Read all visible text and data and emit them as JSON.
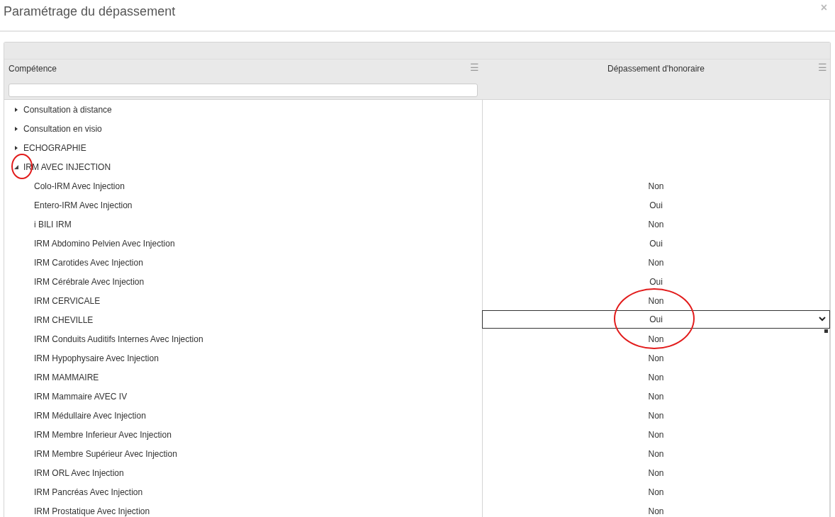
{
  "dialog": {
    "title": "Paramétrage du dépassement",
    "close": "×"
  },
  "grid": {
    "columns": [
      {
        "label": "Compétence",
        "menu": "☰"
      },
      {
        "label": "Dépassement d'honoraire",
        "menu": "☰"
      }
    ],
    "rows": [
      {
        "label": "Consultation à distance",
        "expanded": false,
        "circled": false,
        "children": []
      },
      {
        "label": "Consultation en visio",
        "expanded": false,
        "circled": false,
        "children": []
      },
      {
        "label": "ECHOGRAPHIE",
        "expanded": false,
        "circled": false,
        "children": []
      },
      {
        "label": "IRM AVEC INJECTION",
        "expanded": true,
        "circled": true,
        "children": [
          {
            "label": "Colo-IRM Avec Injection",
            "value": "Non",
            "editing": false,
            "circled": false
          },
          {
            "label": "Entero-IRM Avec Injection",
            "value": "Oui",
            "editing": false,
            "circled": false
          },
          {
            "label": "i BILI IRM",
            "value": "Non",
            "editing": false,
            "circled": false
          },
          {
            "label": "IRM Abdomino Pelvien Avec Injection",
            "value": "Oui",
            "editing": false,
            "circled": false
          },
          {
            "label": "IRM Carotides Avec Injection",
            "value": "Non",
            "editing": false,
            "circled": false
          },
          {
            "label": "IRM Cérébrale Avec Injection",
            "value": "Oui",
            "editing": false,
            "circled": false
          },
          {
            "label": "IRM CERVICALE",
            "value": "Non",
            "editing": false,
            "circled": false
          },
          {
            "label": "IRM CHEVILLE",
            "value": "Oui",
            "editing": true,
            "circled": true
          },
          {
            "label": "IRM Conduits Auditifs Internes Avec Injection",
            "value": "Non",
            "editing": false,
            "circled": false
          },
          {
            "label": "IRM Hypophysaire Avec Injection",
            "value": "Non",
            "editing": false,
            "circled": false
          },
          {
            "label": "IRM MAMMAIRE",
            "value": "Non",
            "editing": false,
            "circled": false
          },
          {
            "label": "IRM Mammaire AVEC IV",
            "value": "Non",
            "editing": false,
            "circled": false
          },
          {
            "label": "IRM Médullaire Avec Injection",
            "value": "Non",
            "editing": false,
            "circled": false
          },
          {
            "label": "IRM Membre Inferieur Avec Injection",
            "value": "Non",
            "editing": false,
            "circled": false
          },
          {
            "label": "IRM Membre Supérieur Avec Injection",
            "value": "Non",
            "editing": false,
            "circled": false
          },
          {
            "label": "IRM ORL Avec Injection",
            "value": "Non",
            "editing": false,
            "circled": false
          },
          {
            "label": "IRM Pancréas Avec Injection",
            "value": "Non",
            "editing": false,
            "circled": false
          },
          {
            "label": "IRM Prostatique Avec Injection",
            "value": "Non",
            "editing": false,
            "circled": false
          }
        ]
      }
    ]
  }
}
